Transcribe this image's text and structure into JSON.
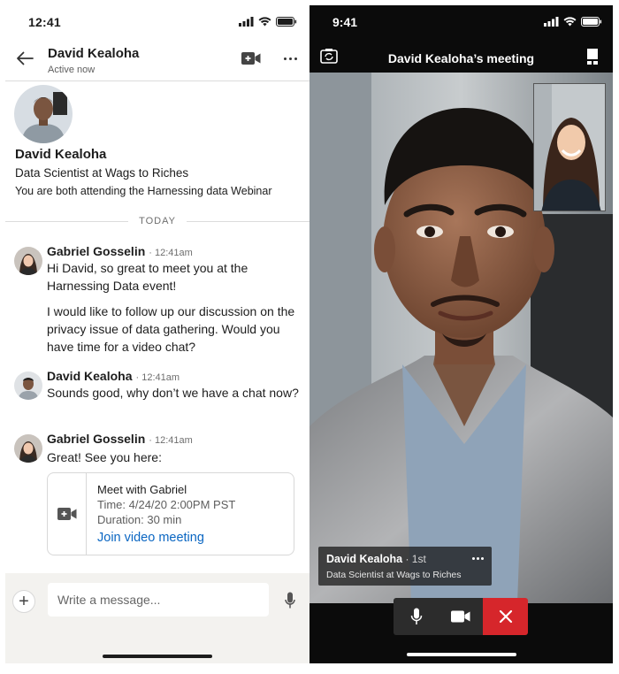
{
  "colors": {
    "accent_link": "#0a66c2",
    "end_call": "#d6262b",
    "composer_bg": "#f3f2ef"
  },
  "chat": {
    "status_bar": {
      "time": "12:41"
    },
    "header": {
      "name": "David Kealoha",
      "status": "Active now",
      "icons": [
        "back-arrow-icon",
        "video-camera-plus-icon",
        "more-dots-icon"
      ]
    },
    "profile": {
      "name": "David Kealoha",
      "title": "Data Scientist at Wags to Riches",
      "common": "You are both attending the Harnessing data Webinar"
    },
    "day_divider": "TODAY",
    "messages": [
      {
        "sender": "Gabriel Gosselin",
        "time": "12:41am",
        "paragraphs": [
          "Hi David, so great to meet you at the Harnessing Data event!",
          "I would like to follow up our discussion on the privacy issue of data gathering. Would you have time for a video chat?"
        ]
      },
      {
        "sender": "David Kealoha",
        "time": "12:41am",
        "paragraphs": [
          "Sounds good, why don’t we have a chat now?"
        ]
      },
      {
        "sender": "Gabriel Gosselin",
        "time": "12:41am",
        "paragraphs": [
          "Great! See you here:"
        ]
      }
    ],
    "meeting_card": {
      "title": "Meet with Gabriel",
      "time": "Time: 4/24/20 2:00PM PST",
      "duration": "Duration: 30 min",
      "join_label": "Join video meeting"
    },
    "composer": {
      "add_label": "+",
      "placeholder": "Write a message..."
    }
  },
  "meeting": {
    "status_bar": {
      "time": "9:41"
    },
    "title": "David Kealoha’s meeting",
    "participant": {
      "name": "David Kealoha",
      "degree": " · 1st",
      "subtitle": "Data Scientist at Wags to Riches"
    },
    "controls": [
      "microphone-icon",
      "video-camera-icon",
      "end-call-x-icon"
    ]
  }
}
